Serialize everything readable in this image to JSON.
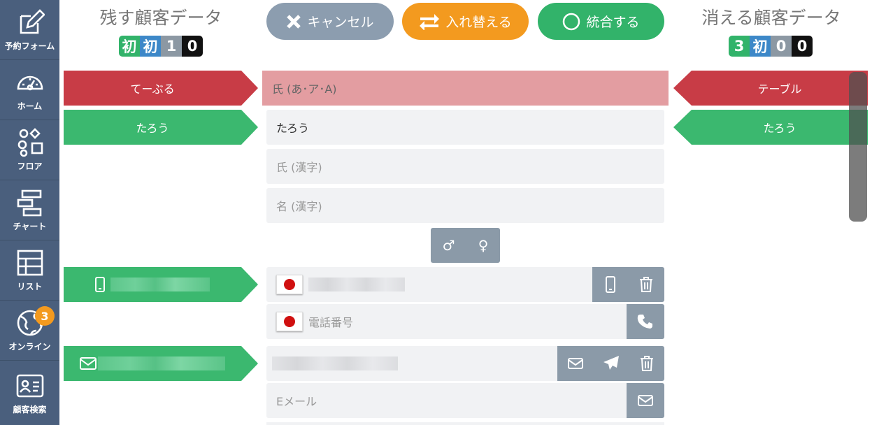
{
  "sidebar": {
    "items": [
      {
        "label": "予約フォーム",
        "icon": "edit-icon"
      },
      {
        "label": "ホーム",
        "icon": "dashboard-icon"
      },
      {
        "label": "フロア",
        "icon": "shapes-icon"
      },
      {
        "label": "チャート",
        "icon": "chart-icon"
      },
      {
        "label": "リスト",
        "icon": "table-icon"
      },
      {
        "label": "オンライン",
        "icon": "globe-icon",
        "badge": "3"
      },
      {
        "label": "顧客検索",
        "icon": "contact-card-icon"
      }
    ]
  },
  "left_column": {
    "title": "残す顧客データ",
    "counters": [
      "初",
      "初",
      "1",
      "0"
    ]
  },
  "right_column": {
    "title": "消える顧客データ",
    "counters": [
      "3",
      "初",
      "0",
      "0"
    ]
  },
  "actions": {
    "cancel": "キャンセル",
    "swap": "入れ替える",
    "merge": "統合する"
  },
  "rows": {
    "last_kana": {
      "left": "てーぶる",
      "placeholder": "氏 (あ･ア･A)",
      "right": "テーブル"
    },
    "first_kana": {
      "left": "たろう",
      "value": "たろう",
      "right": "たろう"
    },
    "last_kanji": {
      "placeholder": "氏 (漢字)"
    },
    "first_kanji": {
      "placeholder": "名 (漢字)"
    },
    "phone2": {
      "placeholder": "電話番号"
    },
    "email2": {
      "placeholder": "Eメール"
    }
  },
  "gender": {
    "male": "♂",
    "female": "♀"
  },
  "colors": {
    "sidebar": "#4a5f7d",
    "red": "#c83c46",
    "green": "#3bb86f",
    "orange": "#f39a1f",
    "slate": "#8b9aa8"
  }
}
